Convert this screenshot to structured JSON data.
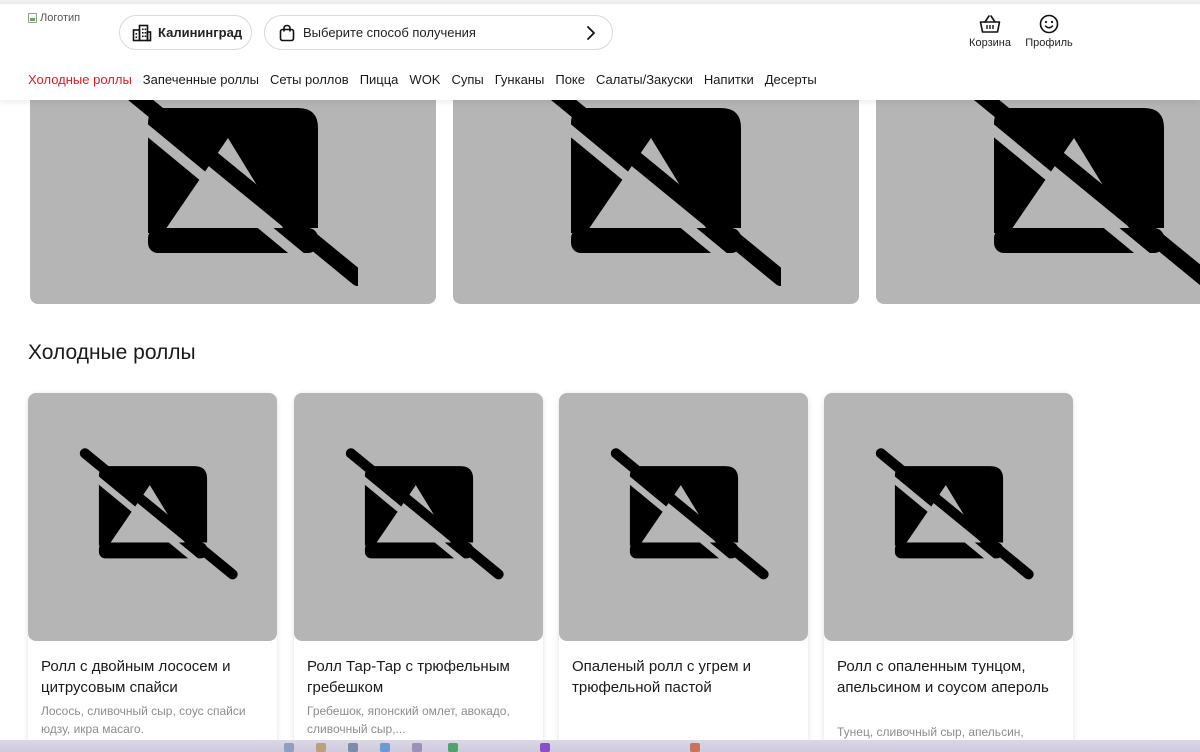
{
  "header": {
    "logo_alt": "Логотип",
    "city_label": "Калининград",
    "delivery_label": "Выберите способ получения",
    "cart_label": "Корзина",
    "profile_label": "Профиль"
  },
  "nav": {
    "items": [
      {
        "label": "Холодные роллы",
        "active": true
      },
      {
        "label": "Запеченные роллы",
        "active": false
      },
      {
        "label": "Сеты роллов",
        "active": false
      },
      {
        "label": "Пицца",
        "active": false
      },
      {
        "label": "WOK",
        "active": false
      },
      {
        "label": "Супы",
        "active": false
      },
      {
        "label": "Гунканы",
        "active": false
      },
      {
        "label": "Поке",
        "active": false
      },
      {
        "label": "Салаты/Закуски",
        "active": false
      },
      {
        "label": "Напитки",
        "active": false
      },
      {
        "label": "Десерты",
        "active": false
      }
    ]
  },
  "section": {
    "title": "Холодные роллы"
  },
  "products": [
    {
      "name": "Ролл с двойным лососем и цитрусовым спайси",
      "description": "Лосось, сливочный сыр, соус спайси юдзу, икра масаго."
    },
    {
      "name": "Ролл Тар-Тар с трюфельным гребешком",
      "description": "Гребешок, японский омлет, авокадо, сливочный сыр,..."
    },
    {
      "name": "Опаленый ролл с угрем и трюфельной пастой",
      "description": ""
    },
    {
      "name": "Ролл с опаленным тунцом, апельсином и соусом апероль",
      "description": "Тунец, сливочный сыр, апельсин,"
    }
  ],
  "colors": {
    "accent": "#e11b22",
    "placeholder_bg": "#b5b5b5",
    "text": "#1a1a1a",
    "muted": "#8c8c8c"
  },
  "icons": {
    "city": "city-buildings-icon",
    "delivery": "shopping-bag-icon",
    "chevron": "chevron-right-icon",
    "cart": "basket-icon",
    "profile": "smiley-face-icon",
    "placeholder": "image-off-icon"
  }
}
